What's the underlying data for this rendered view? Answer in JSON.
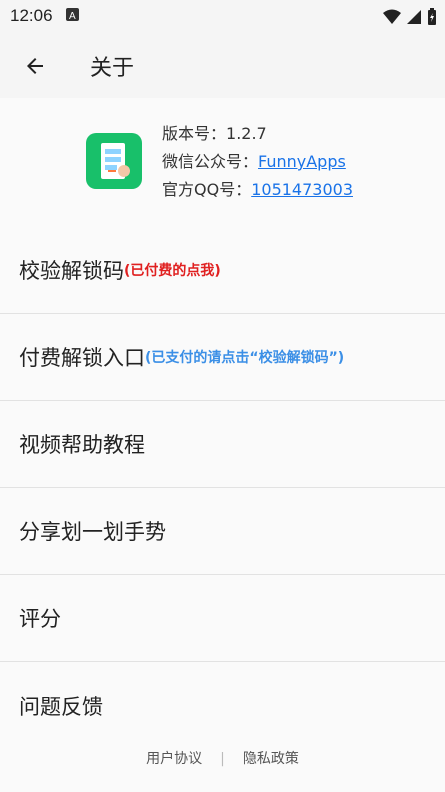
{
  "status_bar": {
    "time": "12:06",
    "notification_icon": "a-notification-icon",
    "icons": [
      "wifi-icon",
      "signal-icon",
      "battery-icon"
    ]
  },
  "app_bar": {
    "back_icon": "arrow-left-icon",
    "title": "关于"
  },
  "app_info": {
    "version_label": "版本号：",
    "version_value": "1.2.7",
    "wechat_label": "微信公众号：",
    "wechat_value": "FunnyApps",
    "qq_label": "官方QQ号：",
    "qq_value": "1051473003"
  },
  "menu": [
    {
      "label": "校验解锁码",
      "note": "(已付费的点我)",
      "note_color": "#e02020"
    },
    {
      "label": "付费解锁入口",
      "note": "(已支付的请点击“校验解锁码”)",
      "note_color": "#3b8fe6"
    },
    {
      "label": "视频帮助教程",
      "note": ""
    },
    {
      "label": "分享划一划手势",
      "note": ""
    },
    {
      "label": "评分",
      "note": ""
    },
    {
      "label": "问题反馈",
      "note": ""
    }
  ],
  "footer": {
    "user_agreement": "用户协议",
    "separator": "|",
    "privacy_policy": "隐私政策"
  }
}
